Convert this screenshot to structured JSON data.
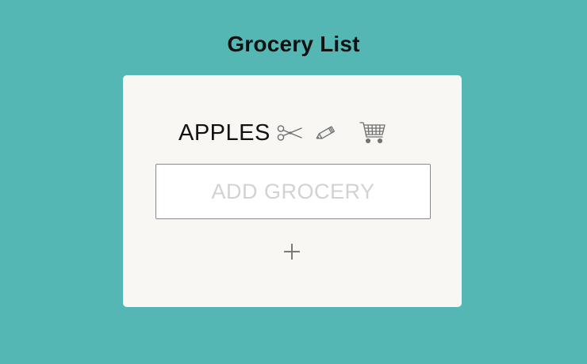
{
  "header": {
    "title": "Grocery List"
  },
  "list": {
    "items": [
      {
        "label": "APPLES",
        "actions": [
          {
            "icon": "scissors-icon"
          },
          {
            "icon": "pencil-icon"
          },
          {
            "icon": "shopping-cart-icon"
          }
        ]
      }
    ]
  },
  "add_form": {
    "input_value": "",
    "placeholder": "ADD GROCERY",
    "add_icon": "plus-icon"
  },
  "colors": {
    "background": "#55b7b4",
    "card": "#f8f7f4",
    "text": "#111111",
    "placeholder": "#d2d2d2",
    "icon": "#777777"
  }
}
